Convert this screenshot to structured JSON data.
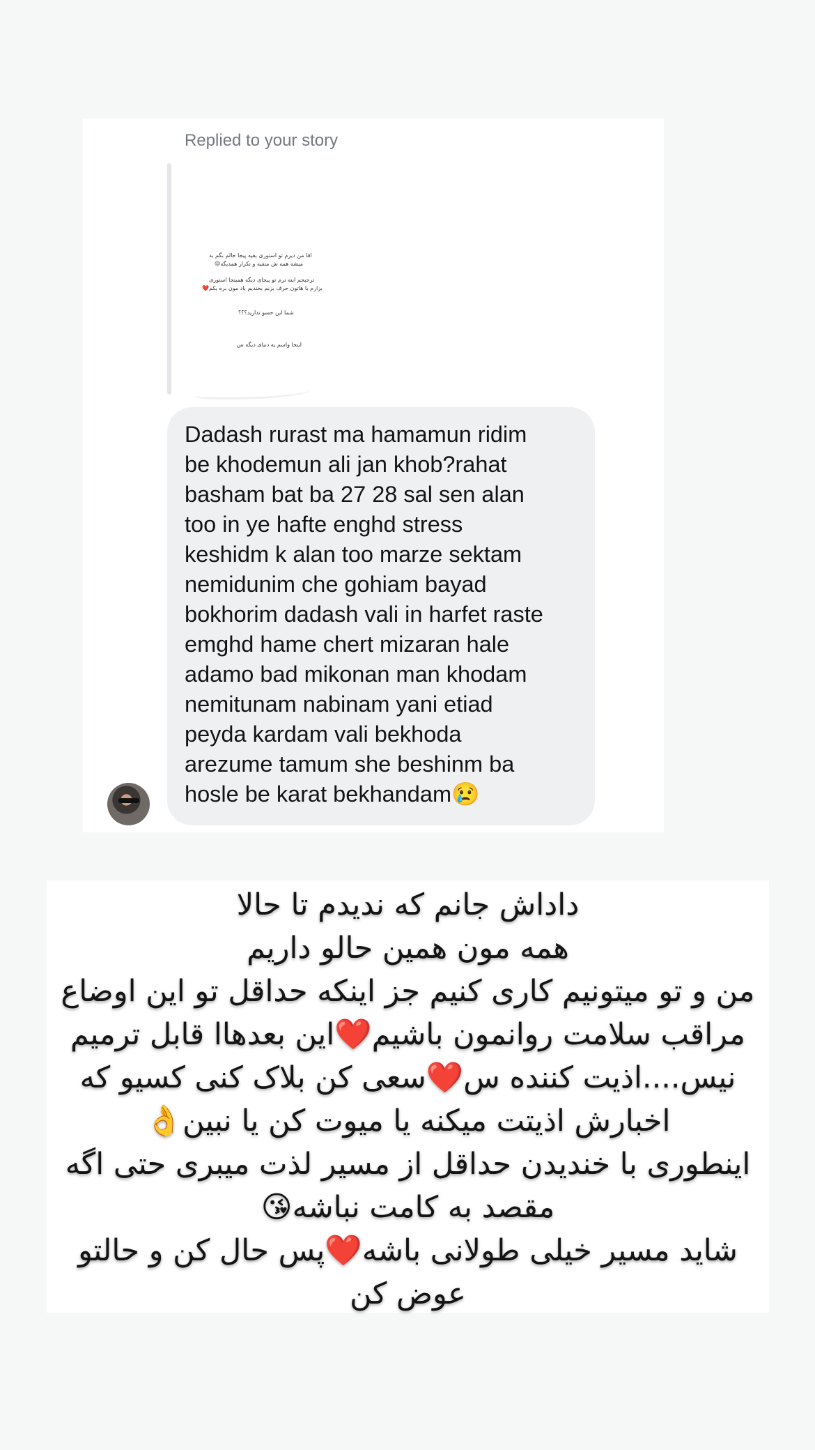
{
  "dm": {
    "reply_label": "Replied to your story",
    "story_preview": {
      "lines": [
        "اقا من دیرم تو استوری بقیه پیجا حالم بگم بد",
        "میشه همه ش منفیه و تکرار همدیگه😔",
        "ترجیحم اینه نرم تو پیجای دیگه همینجا استوری",
        "بزارم با هاتون حرف بزنم بخندیم باد مون بره یکم❤️",
        "شما این حسو ندارید؟؟؟",
        "اینجا واسم یه دنیای دیگه س"
      ]
    },
    "message": "Dadash rurast ma hamamun ridim\nbe khodemun ali jan khob?rahat\nbasham bat ba 27 28 sal sen alan\ntoo in ye hafte enghd stress\nkeshidm k alan too marze sektam\nnemidunim che gohiam bayad\nbokhorim dadash vali in harfet raste\nemghd hame chert mizaran hale\nadamo bad mikonan man khodam\nnemitunam nabinam yani etiad\npeyda kardam vali bekhoda\narezume tamum she beshinm ba\nhosle be karat bekhandam😢"
  },
  "caption": {
    "text": "داداش جانم که ندیدم تا حالا\nهمه مون همین حالو داریم\nمن و تو میتونیم کاری کنیم جز اینکه حداقل تو این اوضاع\nمراقب سلامت روانمون باشیم❤️این بعدهاا قابل ترمیم\nنیس....اذیت کننده س❤️سعی کن بلاک کنی کسیو که\nاخبارش اذیتت میکنه یا میوت کن یا نبین👌\nاینطوری با خندیدن حداقل از مسیر لذت میبری حتی اگه\nمقصد به کامت نباشه😘\nشاید مسیر خیلی طولانی باشه❤️پس حال کن و حالتو\nعوض کن"
  }
}
